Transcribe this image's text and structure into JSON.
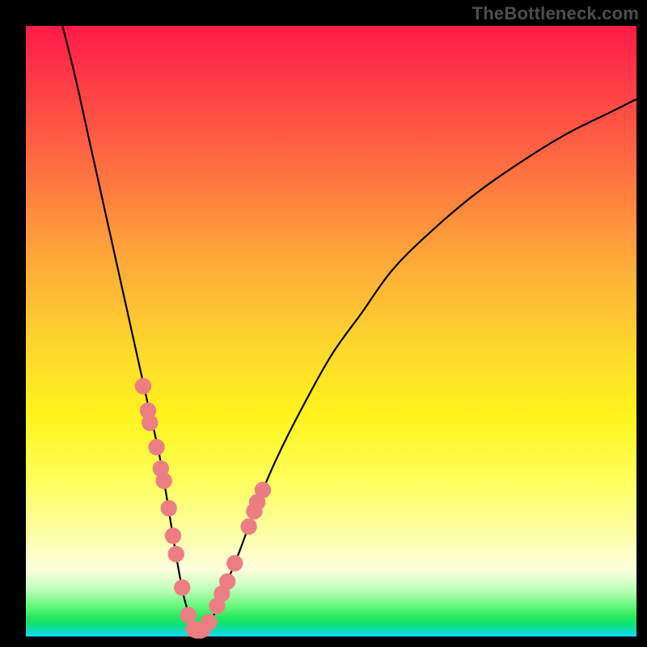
{
  "watermark": "TheBottleneck.com",
  "colors": {
    "background": "#000000",
    "marker": "#ec7e83",
    "curve": "#000000",
    "gradient_top": "#fe1a46",
    "gradient_bottom": "#0ddafe"
  },
  "chart_data": {
    "type": "line",
    "title": "",
    "xlabel": "",
    "ylabel": "",
    "xlim": [
      0,
      100
    ],
    "ylim": [
      0,
      100
    ],
    "curve": {
      "name": "bottleneck-curve",
      "x": [
        6,
        8,
        10,
        12,
        14,
        16,
        18,
        20,
        22,
        24,
        25,
        26,
        27,
        28,
        29,
        30,
        31,
        33,
        35,
        38,
        41,
        45,
        50,
        55,
        60,
        66,
        73,
        80,
        88,
        96,
        100
      ],
      "y": [
        100,
        92,
        83,
        74,
        65,
        56,
        47,
        38,
        29,
        17,
        11,
        6,
        3,
        1,
        1,
        2,
        4,
        9,
        14,
        22,
        29,
        37,
        46,
        53,
        60,
        66,
        72,
        77,
        82,
        86,
        88
      ]
    },
    "series": [
      {
        "name": "left-branch-markers",
        "x": [
          19.2,
          20.0,
          20.3,
          21.4,
          22.1,
          22.6,
          23.4,
          24.1,
          24.6,
          25.6,
          26.6,
          27.5
        ],
        "y": [
          41.0,
          37.0,
          35.0,
          31.0,
          27.5,
          25.5,
          21.0,
          16.5,
          13.5,
          8.0,
          3.5,
          1.2
        ]
      },
      {
        "name": "right-branch-markers",
        "x": [
          29.0,
          30.0,
          31.3,
          32.1,
          33.0,
          34.2,
          36.5,
          37.4,
          37.9,
          38.8
        ],
        "y": [
          1.2,
          2.4,
          5.0,
          7.0,
          9.0,
          12.0,
          18.0,
          20.5,
          22.0,
          24.0
        ]
      },
      {
        "name": "bottom-markers",
        "x": [
          27.5,
          28.0,
          28.6,
          29.0
        ],
        "y": [
          1.2,
          1.0,
          1.0,
          1.2
        ]
      }
    ]
  }
}
